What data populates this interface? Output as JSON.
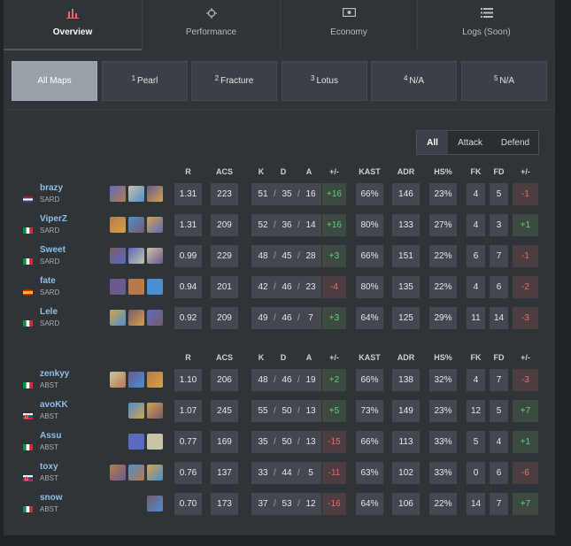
{
  "tabs": [
    {
      "label": "Overview",
      "icon": "bar-chart-icon"
    },
    {
      "label": "Performance",
      "icon": "crosshair-icon"
    },
    {
      "label": "Economy",
      "icon": "cash-icon"
    },
    {
      "label": "Logs (Soon)",
      "icon": "list-icon"
    }
  ],
  "maps": [
    {
      "num": "",
      "name": "All Maps"
    },
    {
      "num": "1",
      "name": "Pearl"
    },
    {
      "num": "2",
      "name": "Fracture"
    },
    {
      "num": "3",
      "name": "Lotus"
    },
    {
      "num": "4",
      "name": "N/A"
    },
    {
      "num": "5",
      "name": "N/A"
    }
  ],
  "filter": {
    "all": "All",
    "attack": "Attack",
    "defend": "Defend"
  },
  "headers": {
    "r": "R",
    "acs": "ACS",
    "k": "K",
    "d": "D",
    "a": "A",
    "pm": "+/-",
    "kast": "KAST",
    "adr": "ADR",
    "hs": "HS%",
    "fk": "FK",
    "fd": "FD",
    "fpm": "+/-"
  },
  "teams": [
    {
      "players": [
        {
          "name": "brazy",
          "team": "SARD",
          "flag": "netherlands",
          "agents": 3,
          "r": "1.31",
          "acs": "223",
          "k": "51",
          "d": "35",
          "a": "16",
          "pm": "+16",
          "kast": "66%",
          "adr": "146",
          "hs": "23%",
          "fk": "4",
          "fd": "5",
          "fpm": "-1"
        },
        {
          "name": "ViperZ",
          "team": "SARD",
          "flag": "italy",
          "agents": 3,
          "r": "1.31",
          "acs": "209",
          "k": "52",
          "d": "36",
          "a": "14",
          "pm": "+16",
          "kast": "80%",
          "adr": "133",
          "hs": "27%",
          "fk": "4",
          "fd": "3",
          "fpm": "+1"
        },
        {
          "name": "Sweet",
          "team": "SARD",
          "flag": "italy",
          "agents": 3,
          "r": "0.99",
          "acs": "229",
          "k": "48",
          "d": "45",
          "a": "28",
          "pm": "+3",
          "kast": "66%",
          "adr": "151",
          "hs": "22%",
          "fk": "6",
          "fd": "7",
          "fpm": "-1"
        },
        {
          "name": "fate",
          "team": "SARD",
          "flag": "spain",
          "agents": 3,
          "r": "0.94",
          "acs": "201",
          "k": "42",
          "d": "46",
          "a": "23",
          "pm": "-4",
          "kast": "80%",
          "adr": "135",
          "hs": "22%",
          "fk": "4",
          "fd": "6",
          "fpm": "-2"
        },
        {
          "name": "Lele",
          "team": "SARD",
          "flag": "italy",
          "agents": 3,
          "r": "0.92",
          "acs": "209",
          "k": "49",
          "d": "46",
          "a": "7",
          "pm": "+3",
          "kast": "64%",
          "adr": "125",
          "hs": "29%",
          "fk": "11",
          "fd": "14",
          "fpm": "-3"
        }
      ]
    },
    {
      "players": [
        {
          "name": "zenkyy",
          "team": "ABST",
          "flag": "italy",
          "agents": 3,
          "r": "1.10",
          "acs": "206",
          "k": "48",
          "d": "46",
          "a": "19",
          "pm": "+2",
          "kast": "66%",
          "adr": "138",
          "hs": "32%",
          "fk": "4",
          "fd": "7",
          "fpm": "-3"
        },
        {
          "name": "avoKK",
          "team": "ABST",
          "flag": "slovakia",
          "agents": 2,
          "r": "1.07",
          "acs": "245",
          "k": "55",
          "d": "50",
          "a": "13",
          "pm": "+5",
          "kast": "73%",
          "adr": "149",
          "hs": "23%",
          "fk": "12",
          "fd": "5",
          "fpm": "+7"
        },
        {
          "name": "Assu",
          "team": "ABST",
          "flag": "italy",
          "agents": 2,
          "r": "0.77",
          "acs": "169",
          "k": "35",
          "d": "50",
          "a": "13",
          "pm": "-15",
          "kast": "66%",
          "adr": "113",
          "hs": "33%",
          "fk": "5",
          "fd": "4",
          "fpm": "+1"
        },
        {
          "name": "toxy",
          "team": "ABST",
          "flag": "slovakia",
          "agents": 3,
          "r": "0.76",
          "acs": "137",
          "k": "33",
          "d": "44",
          "a": "5",
          "pm": "-11",
          "kast": "63%",
          "adr": "102",
          "hs": "33%",
          "fk": "0",
          "fd": "6",
          "fpm": "-6"
        },
        {
          "name": "snow",
          "team": "ABST",
          "flag": "italy",
          "agents": 1,
          "r": "0.70",
          "acs": "173",
          "k": "37",
          "d": "53",
          "a": "12",
          "pm": "-16",
          "kast": "64%",
          "adr": "106",
          "hs": "22%",
          "fk": "14",
          "fd": "7",
          "fpm": "+7"
        }
      ]
    }
  ]
}
